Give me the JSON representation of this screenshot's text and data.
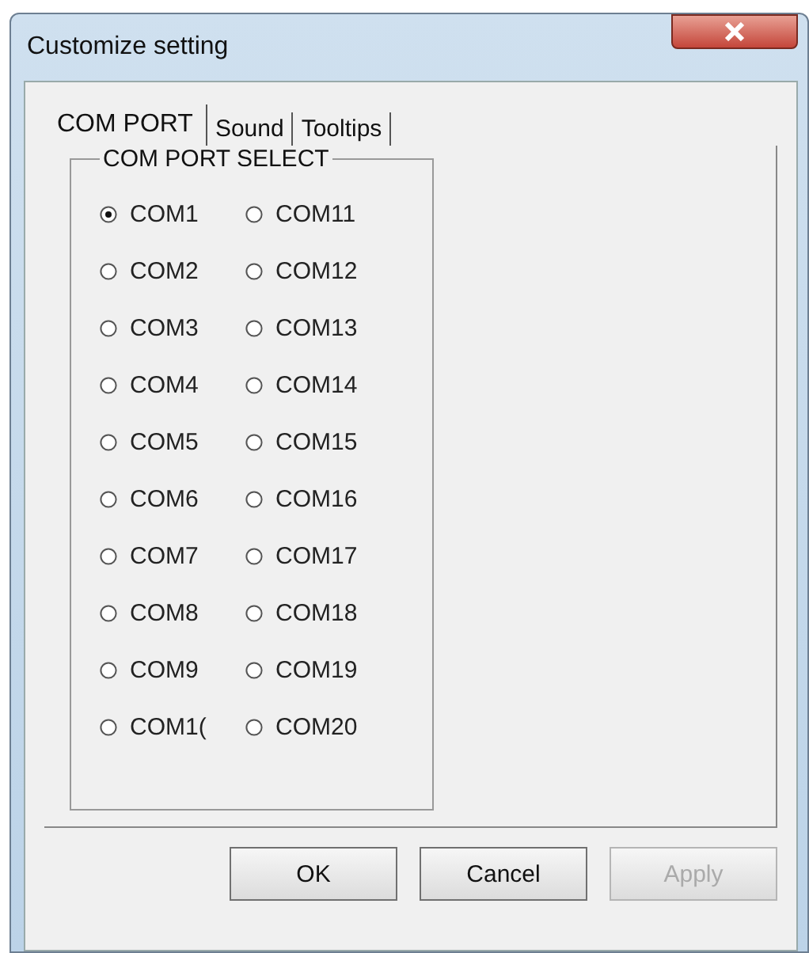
{
  "window": {
    "title": "Customize setting"
  },
  "tabs": [
    {
      "label": "COM PORT",
      "selected": true
    },
    {
      "label": "Sound",
      "selected": false
    },
    {
      "label": "Tooltips",
      "selected": false
    }
  ],
  "group": {
    "title": "COM PORT SELECT"
  },
  "ports": [
    {
      "label": "COM1",
      "selected": true
    },
    {
      "label": "COM2",
      "selected": false
    },
    {
      "label": "COM3",
      "selected": false
    },
    {
      "label": "COM4",
      "selected": false
    },
    {
      "label": "COM5",
      "selected": false
    },
    {
      "label": "COM6",
      "selected": false
    },
    {
      "label": "COM7",
      "selected": false
    },
    {
      "label": "COM8",
      "selected": false
    },
    {
      "label": "COM9",
      "selected": false
    },
    {
      "label": "COM1(",
      "selected": false
    },
    {
      "label": "COM11",
      "selected": false
    },
    {
      "label": "COM12",
      "selected": false
    },
    {
      "label": "COM13",
      "selected": false
    },
    {
      "label": "COM14",
      "selected": false
    },
    {
      "label": "COM15",
      "selected": false
    },
    {
      "label": "COM16",
      "selected": false
    },
    {
      "label": "COM17",
      "selected": false
    },
    {
      "label": "COM18",
      "selected": false
    },
    {
      "label": "COM19",
      "selected": false
    },
    {
      "label": "COM20",
      "selected": false
    }
  ],
  "buttons": [
    {
      "label": "OK",
      "disabled": false
    },
    {
      "label": "Cancel",
      "disabled": false
    },
    {
      "label": "Apply",
      "disabled": true
    }
  ]
}
